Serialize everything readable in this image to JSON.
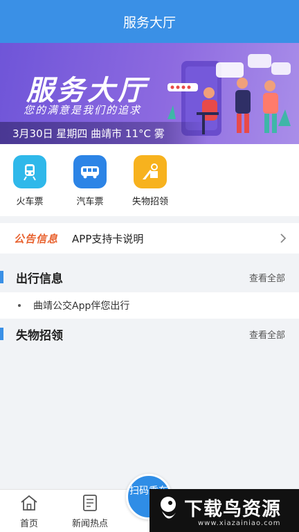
{
  "header": {
    "title": "服务大厅"
  },
  "banner": {
    "title": "服务大厅",
    "subtitle": "您的满意是我们的追求",
    "info": "3月30日 星期四 曲靖市 11°C 雾"
  },
  "quick_actions": [
    {
      "label": "火车票",
      "icon": "train-icon",
      "color": "#2fb8ea"
    },
    {
      "label": "汽车票",
      "icon": "bus-icon",
      "color": "#2c84e6"
    },
    {
      "label": "失物招领",
      "icon": "lost-found-icon",
      "color": "#f7b21e"
    }
  ],
  "notice": {
    "tag": "公告信息",
    "text": "APP支持卡说明"
  },
  "travel": {
    "title": "出行信息",
    "more": "查看全部",
    "items": [
      "曲靖公交App伴您出行"
    ]
  },
  "lost_found": {
    "title": "失物招领",
    "more": "查看全部"
  },
  "scan_button": {
    "label": "扫码乘车"
  },
  "tabbar": [
    {
      "label": "首页",
      "icon": "home-icon"
    },
    {
      "label": "新闻热点",
      "icon": "news-icon"
    }
  ],
  "watermark": {
    "title": "下载鸟资源",
    "url": "www.xiazainiao.com"
  },
  "colors": {
    "primary": "#3a90e6",
    "notice": "#e8622f"
  }
}
